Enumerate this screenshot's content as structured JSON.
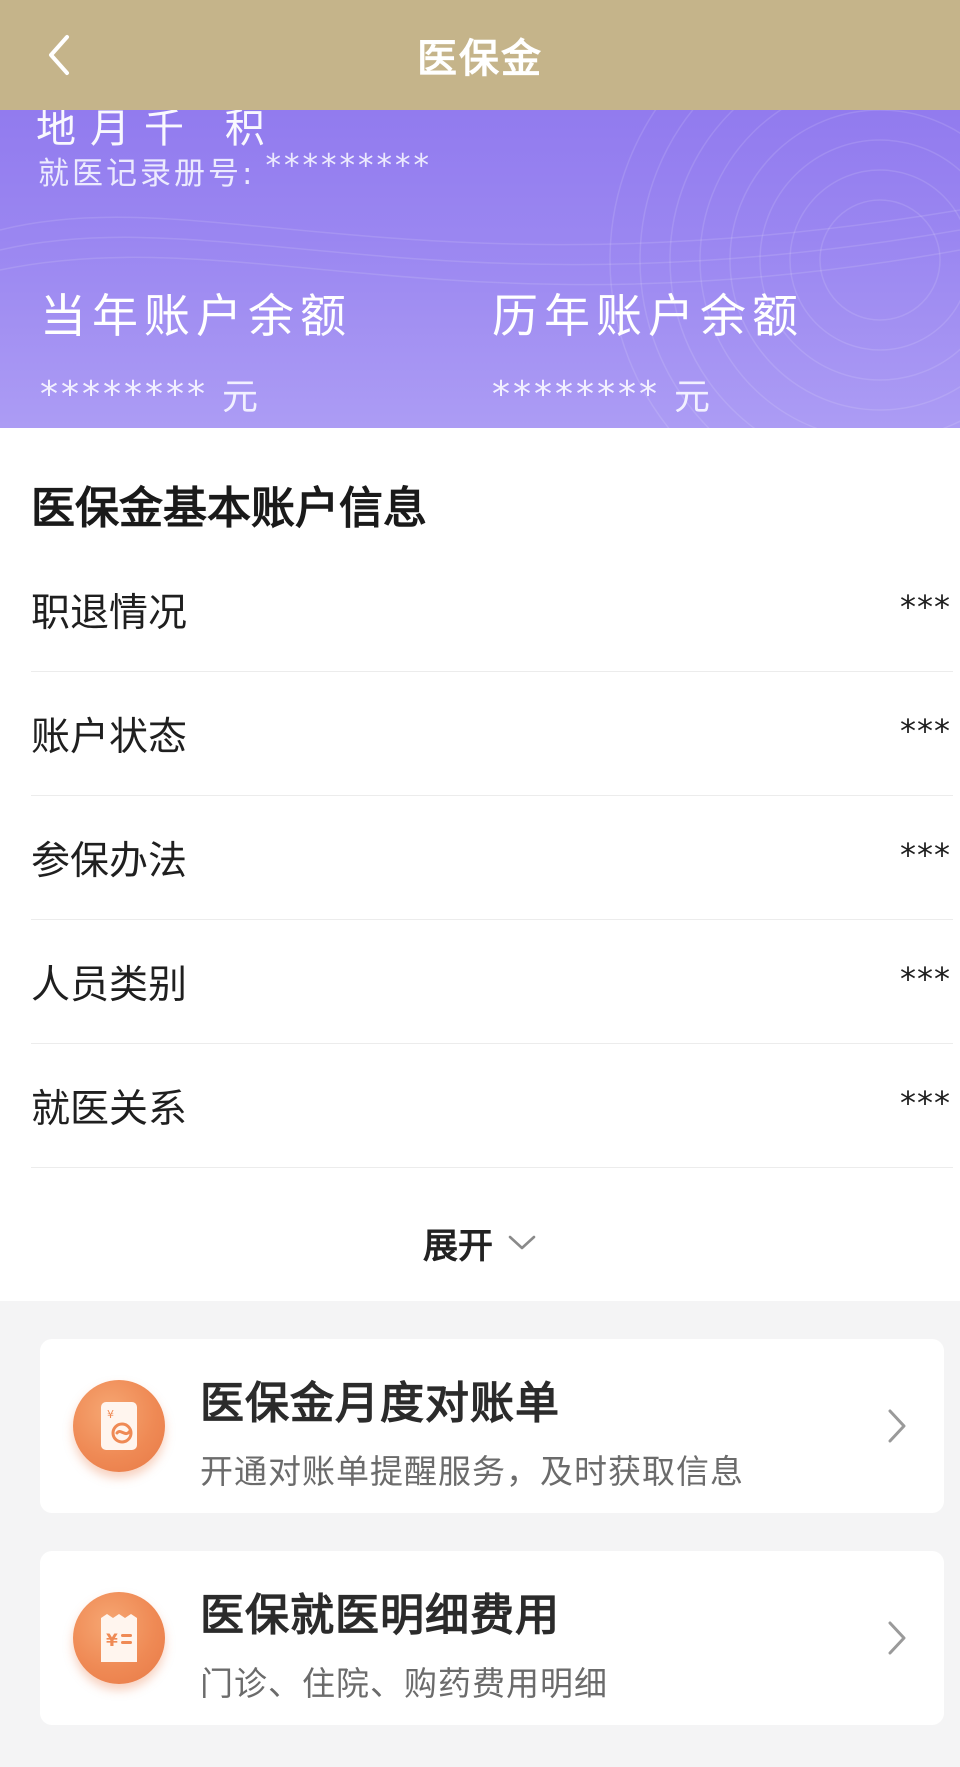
{
  "nav": {
    "title": "医保金",
    "back_icon": "chevron-left-icon"
  },
  "hero": {
    "name_cut": "地月千 积",
    "record_label": "就医记录册号:",
    "record_value": "*********",
    "current_year": {
      "label": "当年账户余额",
      "value": "********",
      "unit": "元"
    },
    "history_years": {
      "label": "历年账户余额",
      "value": "********",
      "unit": "元"
    },
    "colors": {
      "gradient_top": "#8a71ec",
      "gradient_bottom": "#ac9cf4"
    }
  },
  "basic_info": {
    "title": "医保金基本账户信息",
    "rows": [
      {
        "label": "职退情况",
        "value": "***"
      },
      {
        "label": "账户状态",
        "value": "***"
      },
      {
        "label": "参保办法",
        "value": "***"
      },
      {
        "label": "人员类别",
        "value": "***"
      },
      {
        "label": "就医关系",
        "value": "***"
      }
    ],
    "expand_label": "展开",
    "expand_icon": "chevron-down-icon"
  },
  "services": [
    {
      "title": "医保金月度对账单",
      "subtitle": "开通对账单提醒服务，及时获取信息",
      "icon": "statement-icon"
    },
    {
      "title": "医保就医明细费用",
      "subtitle": "门诊、住院、购药费用明细",
      "icon": "receipt-icon"
    }
  ],
  "colors": {
    "navbar": "#c5b48a",
    "icon_orange": "#ef8a55",
    "page_bg": "#f4f4f5"
  }
}
